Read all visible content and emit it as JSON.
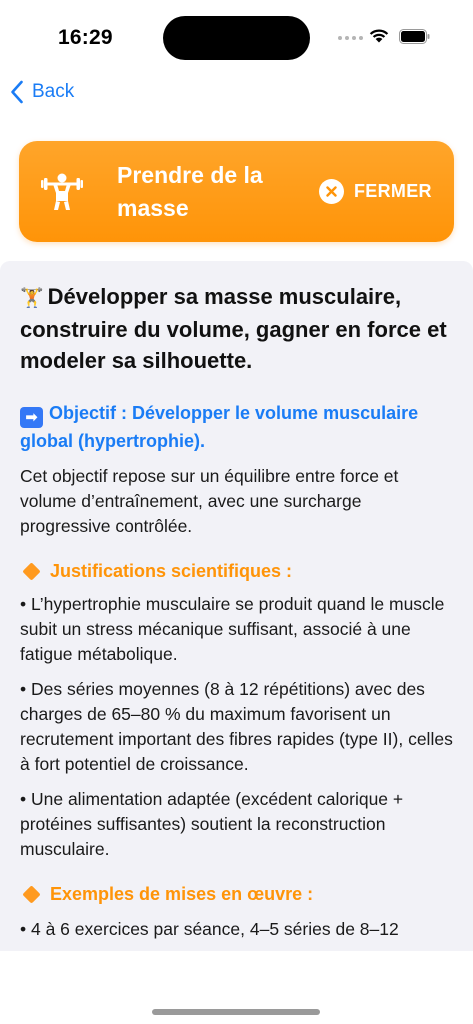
{
  "status_bar": {
    "time": "16:29"
  },
  "nav": {
    "back_label": "Back"
  },
  "goal_card": {
    "title": "Prendre de la masse",
    "close_label": "FERMER",
    "accent_color": "#ff9408"
  },
  "content": {
    "headline": "Développer sa masse musculaire, construire du volume, gagner en force et modeler sa silhouette.",
    "headline_emoji": "🏋️",
    "objective": "Objectif : Développer le volume musculaire global (hypertrophie).",
    "objective_arrow": "➡",
    "intro": "Cet objectif repose sur un équilibre entre force et volume d’entraînement, avec une surcharge progressive contrôlée.",
    "sections": [
      {
        "title": "Justifications scientifiques :",
        "bullets": [
          "• L’hypertrophie musculaire se produit quand le muscle subit un stress mécanique suffisant, associé à une fatigue métabolique.",
          "• Des séries moyennes (8 à 12 répétitions) avec des charges de 65–80 % du maximum favorisent un recrutement important des fibres rapides (type II), celles à fort potentiel de croissance.",
          "• Une alimentation adaptée (excédent calorique + protéines suffisantes) soutient la reconstruction musculaire."
        ]
      },
      {
        "title": "Exemples de mises en œuvre :",
        "bullets": [
          "• 4 à 6 exercices par séance, 4–5 séries de 8–12"
        ]
      }
    ]
  }
}
